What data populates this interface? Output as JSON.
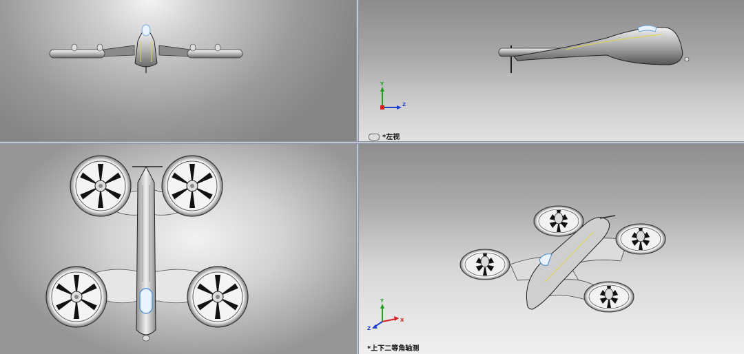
{
  "viewports": {
    "front": {
      "label": ""
    },
    "left": {
      "label": "*左视"
    },
    "top": {
      "label": ""
    },
    "iso": {
      "label": "*上下二等角轴测"
    }
  },
  "triad_axes": {
    "y": "Y",
    "z": "Z",
    "x": "X"
  },
  "colors": {
    "axis_x": "#d22020",
    "axis_y": "#1ea01e",
    "axis_z": "#2040d0",
    "divider": "#c4c8d2"
  }
}
